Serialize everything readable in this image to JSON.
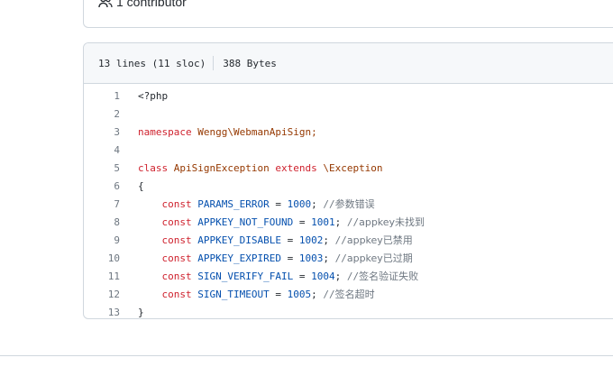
{
  "contributors": {
    "count_label": "1 contributor",
    "icon": "people-icon"
  },
  "file": {
    "lines_info": "13 lines (11 sloc)",
    "size": "388 Bytes"
  },
  "code": {
    "line_numbers": [
      "1",
      "2",
      "3",
      "4",
      "5",
      "6",
      "7",
      "8",
      "9",
      "10",
      "11",
      "12",
      "13"
    ],
    "l1": "<?php",
    "l3_kw": "namespace",
    "l3_ns": "Wengg\\WebmanApiSign;",
    "l5_kw": "class",
    "l5_name": "ApiSignException",
    "l5_ext": "extends",
    "l5_base": "\\Exception",
    "l6": "{",
    "consts": [
      {
        "kw": "const",
        "name": "PARAMS_ERROR",
        "eq": " = ",
        "val": "1000",
        "semi": "; ",
        "comment_slash": "//",
        "comment": "参数错误"
      },
      {
        "kw": "const",
        "name": "APPKEY_NOT_FOUND",
        "eq": " = ",
        "val": "1001",
        "semi": "; ",
        "comment_slash": "//",
        "comment": "appkey未找到"
      },
      {
        "kw": "const",
        "name": "APPKEY_DISABLE",
        "eq": " = ",
        "val": "1002",
        "semi": "; ",
        "comment_slash": "//",
        "comment": "appkey已禁用"
      },
      {
        "kw": "const",
        "name": "APPKEY_EXPIRED",
        "eq": " = ",
        "val": "1003",
        "semi": "; ",
        "comment_slash": "//",
        "comment": "appkey已过期"
      },
      {
        "kw": "const",
        "name": "SIGN_VERIFY_FAIL",
        "eq": " = ",
        "val": "1004",
        "semi": "; ",
        "comment_slash": "//",
        "comment": "签名验证失败"
      },
      {
        "kw": "const",
        "name": "SIGN_TIMEOUT",
        "eq": " = ",
        "val": "1005",
        "semi": "; ",
        "comment_slash": "//",
        "comment": "签名超时"
      }
    ],
    "l13": "}"
  }
}
